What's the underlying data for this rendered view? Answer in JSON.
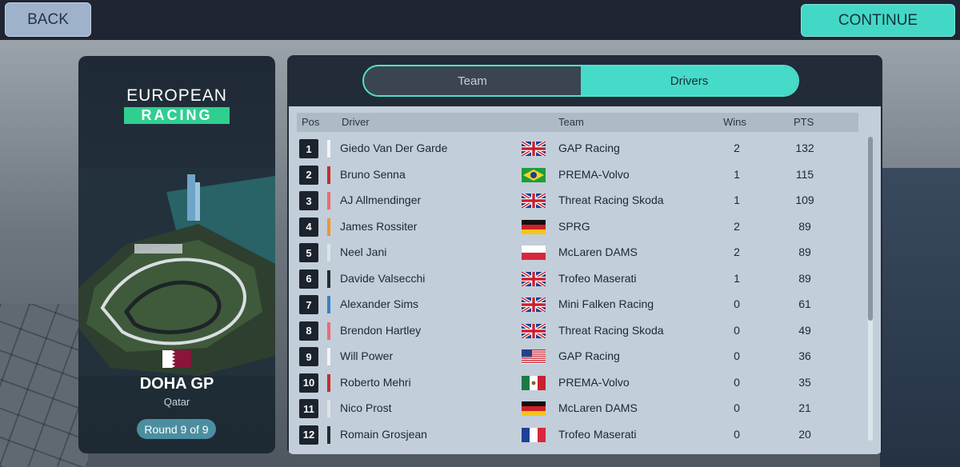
{
  "nav": {
    "back_label": "BACK",
    "continue_label": "CONTINUE"
  },
  "championship": {
    "logo_top": "EUROPEAN",
    "logo_bottom": "RACING",
    "gp_name": "DOHA GP",
    "gp_country": "Qatar",
    "round_label": "Round 9 of 9"
  },
  "tabs": [
    {
      "label": "Team",
      "active": false
    },
    {
      "label": "Drivers",
      "active": true
    }
  ],
  "table": {
    "headers": {
      "pos": "Pos",
      "driver": "Driver",
      "team": "Team",
      "wins": "Wins",
      "pts": "PTS"
    },
    "rows": [
      {
        "pos": "1",
        "driver": "Giedo Van Der Garde",
        "team_color": "#f4f4f4",
        "flag": "gb-flag",
        "team": "GAP Racing",
        "wins": "2",
        "pts": "132"
      },
      {
        "pos": "2",
        "driver": "Bruno Senna",
        "team_color": "#c0302e",
        "flag": "br-flag",
        "team": "PREMA-Volvo",
        "wins": "1",
        "pts": "115"
      },
      {
        "pos": "3",
        "driver": "AJ Allmendinger",
        "team_color": "#ee6a72",
        "flag": "gb-flag",
        "team": "Threat Racing Skoda",
        "wins": "1",
        "pts": "109"
      },
      {
        "pos": "4",
        "driver": "James Rossiter",
        "team_color": "#f0962e",
        "flag": "de-flag",
        "team": "SPRG",
        "wins": "2",
        "pts": "89"
      },
      {
        "pos": "5",
        "driver": "Neel Jani",
        "team_color": "#dfe3e6",
        "flag": "pl-flag",
        "team": "McLaren DAMS",
        "wins": "2",
        "pts": "89"
      },
      {
        "pos": "6",
        "driver": "Davide Valsecchi",
        "team_color": "#262b33",
        "flag": "gb-flag",
        "team": "Trofeo Maserati",
        "wins": "1",
        "pts": "89"
      },
      {
        "pos": "7",
        "driver": "Alexander Sims",
        "team_color": "#3b7ec4",
        "flag": "gb-flag",
        "team": "Mini Falken Racing",
        "wins": "0",
        "pts": "61"
      },
      {
        "pos": "8",
        "driver": "Brendon Hartley",
        "team_color": "#ee6a72",
        "flag": "gb-flag",
        "team": "Threat Racing Skoda",
        "wins": "0",
        "pts": "49"
      },
      {
        "pos": "9",
        "driver": "Will Power",
        "team_color": "#f4f4f4",
        "flag": "us-flag",
        "team": "GAP Racing",
        "wins": "0",
        "pts": "36"
      },
      {
        "pos": "10",
        "driver": "Roberto Mehri",
        "team_color": "#c0302e",
        "flag": "mx-flag",
        "team": "PREMA-Volvo",
        "wins": "0",
        "pts": "35"
      },
      {
        "pos": "11",
        "driver": "Nico Prost",
        "team_color": "#dfe3e6",
        "flag": "de-flag",
        "team": "McLaren DAMS",
        "wins": "0",
        "pts": "21"
      },
      {
        "pos": "12",
        "driver": "Romain Grosjean",
        "team_color": "#262b33",
        "flag": "fr-flag",
        "team": "Trofeo Maserati",
        "wins": "0",
        "pts": "20"
      }
    ]
  },
  "colors": {
    "accent": "#45dbc8",
    "panel": "#222b38",
    "table_bg": "#c2ced9"
  }
}
